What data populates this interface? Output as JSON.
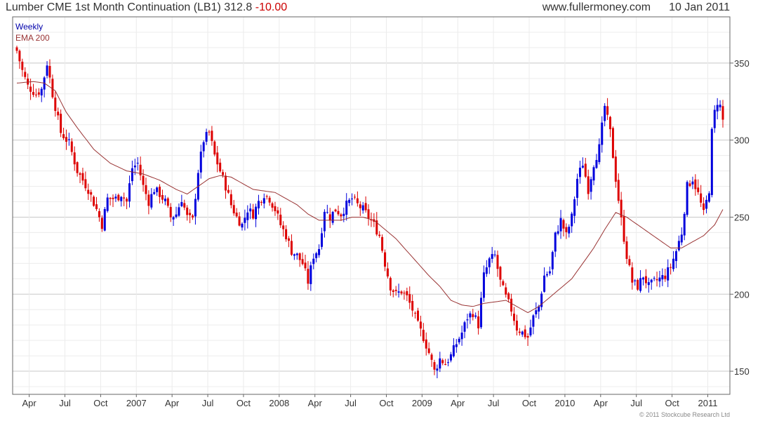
{
  "header": {
    "title": "Lumber CME 1st Month Continuation (LB1) 312.8",
    "change": "-10.00",
    "site": "www.fullermoney.com",
    "date": "10 Jan 2011"
  },
  "footer": {
    "copyright": "© 2011 Stockcube Research Ltd"
  },
  "colors": {
    "up": "#0000dd",
    "down": "#dd0000",
    "ema": "#993333",
    "grid": "#d8d8d8",
    "legend_weekly": "#0000aa",
    "legend_ema": "#993333"
  },
  "chart_data": {
    "type": "candlestick",
    "ylim": [
      135,
      380
    ],
    "y_ticks": [
      150,
      200,
      250,
      300,
      350
    ],
    "legend": [
      "Weekly",
      "EMA 200"
    ],
    "x_labels": [
      {
        "label": "Apr",
        "week": 4.5
      },
      {
        "label": "Jul",
        "week": 17.5
      },
      {
        "label": "Oct",
        "week": 30.5
      },
      {
        "label": "2007",
        "week": 43.5
      },
      {
        "label": "Apr",
        "week": 56.5
      },
      {
        "label": "Jul",
        "week": 69.5
      },
      {
        "label": "Oct",
        "week": 82.5
      },
      {
        "label": "2008",
        "week": 95.5
      },
      {
        "label": "Apr",
        "week": 108.5
      },
      {
        "label": "Jul",
        "week": 121.5
      },
      {
        "label": "Oct",
        "week": 134.5
      },
      {
        "label": "2009",
        "week": 147.5
      },
      {
        "label": "Apr",
        "week": 160.5
      },
      {
        "label": "Jul",
        "week": 173.5
      },
      {
        "label": "Oct",
        "week": 186.5
      },
      {
        "label": "2010",
        "week": 199.5
      },
      {
        "label": "Apr",
        "week": 212.5
      },
      {
        "label": "Jul",
        "week": 225.5
      },
      {
        "label": "Oct",
        "week": 238.5
      },
      {
        "label": "2011",
        "week": 251.5
      }
    ],
    "close_anchors": [
      [
        0,
        358
      ],
      [
        2,
        345
      ],
      [
        4,
        335
      ],
      [
        7,
        330
      ],
      [
        9,
        333
      ],
      [
        11,
        350
      ],
      [
        13,
        330
      ],
      [
        16,
        305
      ],
      [
        19,
        298
      ],
      [
        22,
        280
      ],
      [
        26,
        268
      ],
      [
        29,
        255
      ],
      [
        31,
        245
      ],
      [
        33,
        262
      ],
      [
        36,
        262
      ],
      [
        38,
        265
      ],
      [
        40,
        260
      ],
      [
        42,
        282
      ],
      [
        44,
        285
      ],
      [
        46,
        270
      ],
      [
        48,
        260
      ],
      [
        50,
        268
      ],
      [
        52,
        265
      ],
      [
        54,
        260
      ],
      [
        56,
        250
      ],
      [
        58,
        252
      ],
      [
        60,
        262
      ],
      [
        62,
        250
      ],
      [
        64,
        248
      ],
      [
        66,
        280
      ],
      [
        68,
        300
      ],
      [
        70,
        305
      ],
      [
        72,
        290
      ],
      [
        74,
        280
      ],
      [
        76,
        270
      ],
      [
        78,
        258
      ],
      [
        80,
        250
      ],
      [
        82,
        245
      ],
      [
        84,
        255
      ],
      [
        86,
        252
      ],
      [
        88,
        260
      ],
      [
        90,
        265
      ],
      [
        92,
        262
      ],
      [
        94,
        255
      ],
      [
        96,
        245
      ],
      [
        98,
        238
      ],
      [
        100,
        228
      ],
      [
        102,
        225
      ],
      [
        104,
        220
      ],
      [
        106,
        208
      ],
      [
        108,
        225
      ],
      [
        110,
        230
      ],
      [
        112,
        255
      ],
      [
        114,
        250
      ],
      [
        116,
        255
      ],
      [
        118,
        252
      ],
      [
        120,
        258
      ],
      [
        122,
        262
      ],
      [
        124,
        258
      ],
      [
        126,
        255
      ],
      [
        128,
        250
      ],
      [
        130,
        245
      ],
      [
        132,
        238
      ],
      [
        134,
        220
      ],
      [
        136,
        205
      ],
      [
        138,
        200
      ],
      [
        140,
        202
      ],
      [
        142,
        198
      ],
      [
        144,
        190
      ],
      [
        146,
        180
      ],
      [
        148,
        172
      ],
      [
        150,
        162
      ],
      [
        152,
        150
      ],
      [
        154,
        158
      ],
      [
        156,
        155
      ],
      [
        158,
        160
      ],
      [
        160,
        168
      ],
      [
        162,
        175
      ],
      [
        164,
        185
      ],
      [
        166,
        188
      ],
      [
        168,
        180
      ],
      [
        170,
        212
      ],
      [
        172,
        222
      ],
      [
        174,
        225
      ],
      [
        176,
        208
      ],
      [
        178,
        198
      ],
      [
        180,
        190
      ],
      [
        182,
        178
      ],
      [
        184,
        175
      ],
      [
        186,
        172
      ],
      [
        188,
        185
      ],
      [
        190,
        192
      ],
      [
        192,
        212
      ],
      [
        194,
        215
      ],
      [
        196,
        238
      ],
      [
        198,
        248
      ],
      [
        200,
        238
      ],
      [
        202,
        250
      ],
      [
        204,
        275
      ],
      [
        206,
        285
      ],
      [
        208,
        268
      ],
      [
        210,
        285
      ],
      [
        212,
        295
      ],
      [
        214,
        322
      ],
      [
        216,
        305
      ],
      [
        218,
        275
      ],
      [
        220,
        248
      ],
      [
        222,
        225
      ],
      [
        224,
        208
      ],
      [
        226,
        205
      ],
      [
        228,
        212
      ],
      [
        230,
        205
      ],
      [
        232,
        208
      ],
      [
        234,
        210
      ],
      [
        236,
        212
      ],
      [
        238,
        218
      ],
      [
        240,
        228
      ],
      [
        242,
        240
      ],
      [
        244,
        270
      ],
      [
        246,
        275
      ],
      [
        248,
        265
      ],
      [
        250,
        252
      ],
      [
        252,
        268
      ],
      [
        253,
        305
      ],
      [
        254,
        318
      ],
      [
        255,
        325
      ],
      [
        256,
        322
      ],
      [
        257,
        312.8
      ]
    ],
    "ema_anchors": [
      [
        0,
        337
      ],
      [
        6,
        338
      ],
      [
        10,
        337
      ],
      [
        14,
        332
      ],
      [
        18,
        318
      ],
      [
        22,
        308
      ],
      [
        28,
        294
      ],
      [
        34,
        285
      ],
      [
        40,
        280
      ],
      [
        46,
        278
      ],
      [
        52,
        274
      ],
      [
        58,
        268
      ],
      [
        62,
        265
      ],
      [
        66,
        270
      ],
      [
        70,
        275
      ],
      [
        74,
        277
      ],
      [
        78,
        276
      ],
      [
        82,
        272
      ],
      [
        86,
        268
      ],
      [
        90,
        267
      ],
      [
        94,
        266
      ],
      [
        98,
        262
      ],
      [
        102,
        258
      ],
      [
        106,
        252
      ],
      [
        110,
        248
      ],
      [
        114,
        248
      ],
      [
        118,
        248
      ],
      [
        122,
        250
      ],
      [
        126,
        250
      ],
      [
        130,
        248
      ],
      [
        134,
        242
      ],
      [
        138,
        236
      ],
      [
        142,
        228
      ],
      [
        146,
        220
      ],
      [
        150,
        212
      ],
      [
        154,
        205
      ],
      [
        158,
        196
      ],
      [
        162,
        193
      ],
      [
        166,
        192
      ],
      [
        170,
        194
      ],
      [
        174,
        195
      ],
      [
        178,
        196
      ],
      [
        182,
        192
      ],
      [
        186,
        188
      ],
      [
        190,
        192
      ],
      [
        194,
        198
      ],
      [
        198,
        204
      ],
      [
        202,
        210
      ],
      [
        206,
        220
      ],
      [
        210,
        230
      ],
      [
        214,
        242
      ],
      [
        218,
        253
      ],
      [
        222,
        250
      ],
      [
        226,
        245
      ],
      [
        230,
        240
      ],
      [
        234,
        235
      ],
      [
        238,
        230
      ],
      [
        242,
        230
      ],
      [
        246,
        234
      ],
      [
        250,
        238
      ],
      [
        254,
        245
      ],
      [
        257,
        255
      ]
    ]
  }
}
